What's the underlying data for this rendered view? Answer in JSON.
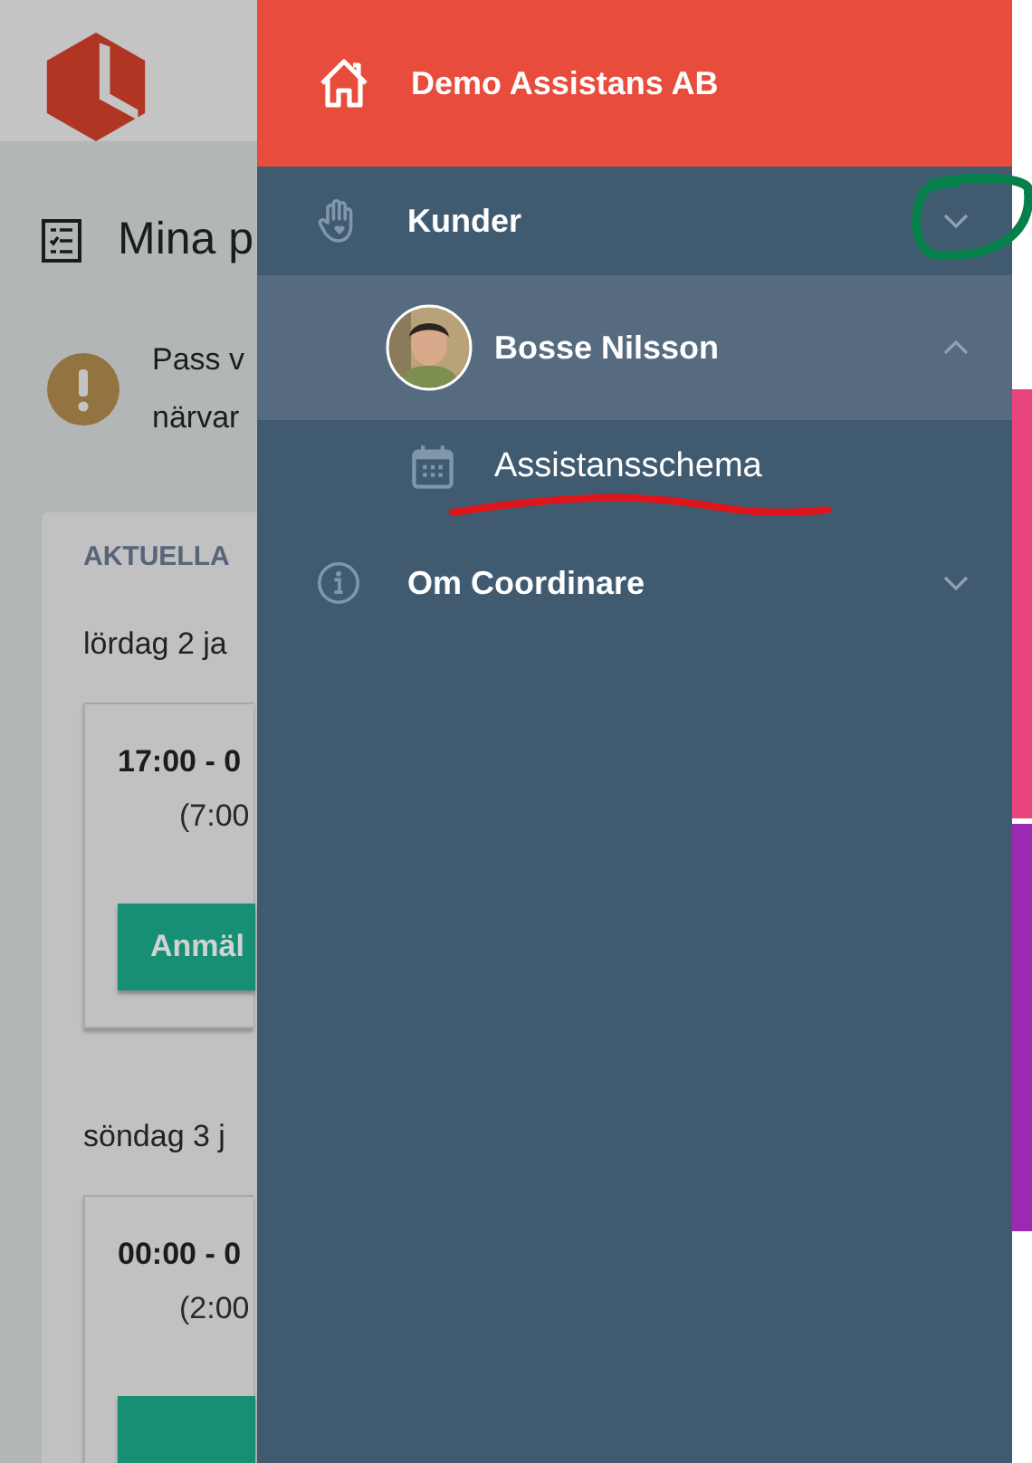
{
  "page": {
    "title": "Mina p",
    "notice": [
      "Pass v",
      "närvar"
    ],
    "section": "AKTUELLA",
    "days": [
      {
        "date": "lördag 2 ja",
        "shifts": [
          {
            "time": "17:00 - 0",
            "duration": "(7:00",
            "button": "Anmäl"
          }
        ]
      },
      {
        "date": "söndag 3 j",
        "shifts": [
          {
            "time": "00:00 - 0",
            "duration": "(2:00"
          }
        ]
      }
    ]
  },
  "drawer": {
    "header": {
      "label": "Demo Assistans AB"
    },
    "items": [
      {
        "label": "Kunder",
        "expanded": false,
        "selected": false,
        "children": [
          {
            "label": "Bosse Nilsson",
            "expanded": true,
            "selected": true,
            "children": [
              {
                "label": "Assistansschema",
                "selected": false
              }
            ]
          }
        ]
      },
      {
        "label": "Om Coordinare",
        "expanded": false,
        "selected": false
      }
    ]
  },
  "side_strip": {
    "blocks": [
      {
        "color": "#e9447f"
      },
      {
        "color": "#9c29b1"
      }
    ]
  },
  "annotations": [
    {
      "kind": "circle"
    },
    {
      "kind": "underline"
    }
  ]
}
